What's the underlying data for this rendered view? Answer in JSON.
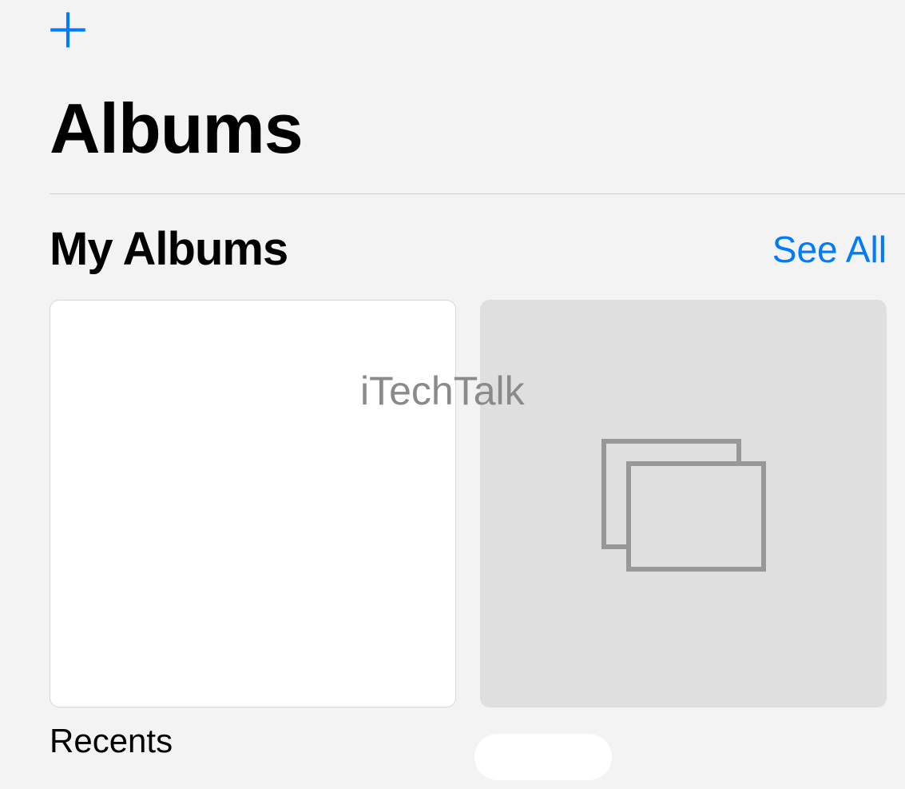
{
  "header": {
    "add_button_glyph": "＋"
  },
  "page": {
    "title": "Albums"
  },
  "section": {
    "title": "My Albums",
    "see_all_label": "See All"
  },
  "albums": {
    "recents_label": "Recents"
  },
  "watermark": {
    "text": "iTechTalk"
  }
}
